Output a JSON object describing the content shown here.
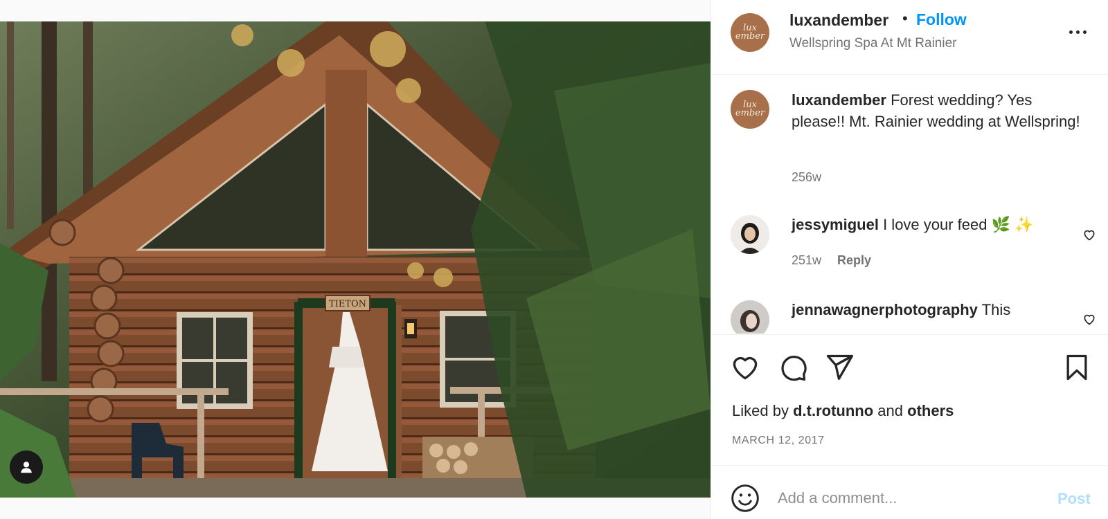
{
  "post": {
    "image_alt": "Log cabin in the forest with a wedding dress hanging by the door",
    "cabin_sign": "TIETON"
  },
  "header": {
    "avatar_text_line1": "lux",
    "avatar_text_line2": "ember",
    "username": "luxandember",
    "separator": "•",
    "follow_label": "Follow",
    "location": "Wellspring Spa At Mt Rainier"
  },
  "caption": {
    "username": "luxandember",
    "text": "Forest wedding? Yes please!! Mt. Rainier wedding at Wellspring!",
    "time": "256w"
  },
  "comments": [
    {
      "username": "jessymiguel",
      "text": "I love your feed 🌿 ✨",
      "time": "251w",
      "reply_label": "Reply"
    },
    {
      "username": "jennawagnerphotography",
      "text": "This"
    }
  ],
  "likes": {
    "prefix": "Liked by",
    "user": "d.t.rotunno",
    "conjunction": "and",
    "others": "others"
  },
  "date": "MARCH 12, 2017",
  "add_comment": {
    "placeholder": "Add a comment...",
    "post_label": "Post"
  },
  "colors": {
    "accent": "#0095f6",
    "post_disabled": "#b2dffc",
    "text": "#262626",
    "muted": "#737373",
    "avatar_brand": "#a8704a"
  },
  "icons": [
    "person-tag-icon",
    "more-options-icon",
    "heart-icon",
    "comment-icon",
    "share-icon",
    "bookmark-icon",
    "emoji-icon"
  ]
}
